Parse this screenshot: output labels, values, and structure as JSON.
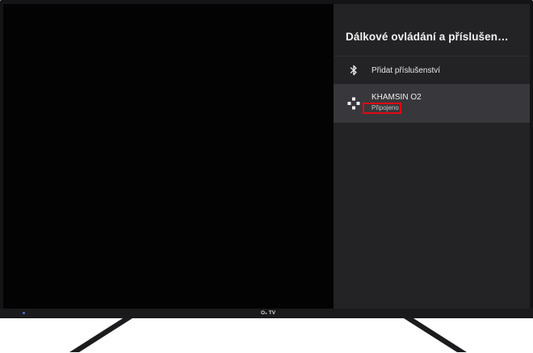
{
  "panel": {
    "title": "Dálkové ovládání a příslušen…",
    "items": [
      {
        "label": "Přidat příslušenství",
        "icon": "bluetooth-icon"
      },
      {
        "label": "KHAMSIN O2",
        "status": "Připojeno",
        "icon": "gamepad-icon",
        "selected": true
      }
    ]
  },
  "tv": {
    "brand": "O₂ TV"
  },
  "colors": {
    "panel_background": "#232326",
    "selected_item_background": "#38383c",
    "highlight_border": "#e30613",
    "screen_background": "#000000",
    "power_led": "#3d6fd8"
  }
}
